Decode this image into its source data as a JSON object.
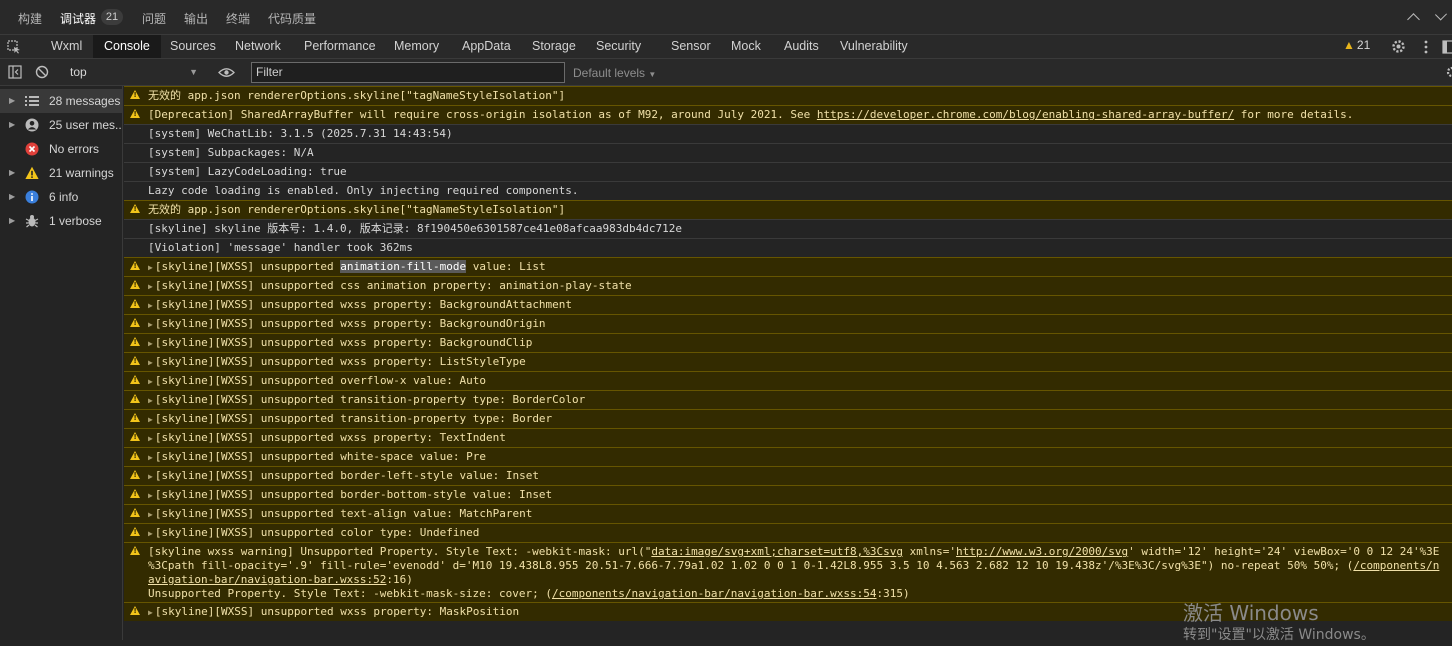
{
  "panel_tabs": [
    "构建",
    "调试器",
    "问题",
    "输出",
    "终端",
    "代码质量"
  ],
  "panel_badge": "21",
  "devtools_tabs": [
    "Wxml",
    "Console",
    "Sources",
    "Network",
    "Performance",
    "Memory",
    "AppData",
    "Storage",
    "Security",
    "Sensor",
    "Mock",
    "Audits",
    "Vulnerability"
  ],
  "warning_count": "21",
  "toolbar": {
    "context": "top",
    "filter_placeholder": "Filter",
    "levels": "Default levels"
  },
  "sidebar": [
    {
      "label": "28 messages",
      "icon": "list-icon"
    },
    {
      "label": "25 user mes...",
      "icon": "user-icon"
    },
    {
      "label": "No errors",
      "icon": "error-icon"
    },
    {
      "label": "21 warnings",
      "icon": "warning-icon"
    },
    {
      "label": "6 info",
      "icon": "info-icon"
    },
    {
      "label": "1 verbose",
      "icon": "bug-icon"
    }
  ],
  "messages": [
    {
      "type": "warn",
      "text": "无效的 app.json rendererOptions.skyline[\"tagNameStyleIsolation\"]"
    },
    {
      "type": "warn",
      "pre": "[Deprecation] SharedArrayBuffer will require cross-origin isolation as of M92, around July 2021. See ",
      "link": "https://developer.chrome.com/blog/enabling-shared-array-buffer/",
      "post": " for more details."
    },
    {
      "type": "log",
      "text": "[system] WeChatLib: 3.1.5 (2025.7.31 14:43:54)"
    },
    {
      "type": "log",
      "text": "[system] Subpackages: N/A"
    },
    {
      "type": "log",
      "text": "[system] LazyCodeLoading: true"
    },
    {
      "type": "log",
      "text": "Lazy code loading is enabled. Only injecting required components."
    },
    {
      "type": "warn",
      "text": "无效的 app.json rendererOptions.skyline[\"tagNameStyleIsolation\"]"
    },
    {
      "type": "log",
      "text": "[skyline] skyline 版本号: 1.4.0, 版本记录: 8f190450e6301587ce41e08afcaa983db4dc712e"
    },
    {
      "type": "log",
      "text": "[Violation] 'message' handler took 362ms"
    },
    {
      "type": "warn-exp",
      "pre": "[skyline][WXSS] unsupported ",
      "hl": "animation-fill-mode",
      "post": " value: List"
    },
    {
      "type": "warn-exp",
      "text": "[skyline][WXSS] unsupported css animation property: animation-play-state"
    },
    {
      "type": "warn-exp",
      "text": "[skyline][WXSS] unsupported wxss property: BackgroundAttachment"
    },
    {
      "type": "warn-exp",
      "text": "[skyline][WXSS] unsupported wxss property: BackgroundOrigin"
    },
    {
      "type": "warn-exp",
      "text": "[skyline][WXSS] unsupported wxss property: BackgroundClip"
    },
    {
      "type": "warn-exp",
      "text": "[skyline][WXSS] unsupported wxss property: ListStyleType"
    },
    {
      "type": "warn-exp",
      "text": "[skyline][WXSS] unsupported overflow-x value: Auto"
    },
    {
      "type": "warn-exp",
      "text": "[skyline][WXSS] unsupported transition-property type: BorderColor"
    },
    {
      "type": "warn-exp",
      "text": "[skyline][WXSS] unsupported transition-property type: Border"
    },
    {
      "type": "warn-exp",
      "text": "[skyline][WXSS] unsupported wxss property: TextIndent"
    },
    {
      "type": "warn-exp",
      "text": "[skyline][WXSS] unsupported white-space value: Pre"
    },
    {
      "type": "warn-exp",
      "text": "[skyline][WXSS] unsupported border-left-style value: Inset"
    },
    {
      "type": "warn-exp",
      "text": "[skyline][WXSS] unsupported border-bottom-style value: Inset"
    },
    {
      "type": "warn-exp",
      "text": "[skyline][WXSS] unsupported text-align value: MatchParent"
    },
    {
      "type": "warn-exp",
      "text": "[skyline][WXSS] unsupported color type: Undefined"
    }
  ],
  "multi_warning": {
    "l1_pre": "[skyline wxss warning] Unsupported Property. Style Text: -webkit-mask: url(\"",
    "l1_link1": "data:image/svg+xml;charset=utf8,%3Csvg",
    "l1_mid": " xmlns='",
    "l1_link2": "http://www.w3.org/2000/svg",
    "l1_post": "' width='12' height='24' viewBox='0 0 12 24'%3E",
    "l2_pre": "%3Cpath fill-opacity='.9' fill-rule='evenodd' d='M10 19.438L8.955 20.51-7.666-7.79a1.02 1.02 0 0 1 0-1.42L8.955 3.5 10 4.563 2.682 12 10 19.438z'/%3E%3C/svg%3E\") no-repeat 50% 50%; (",
    "l2_link": "/components/n",
    "l3_link": "avigation-bar/navigation-bar.wxss:52",
    "l3_post": ":16)",
    "l4_pre": "Unsupported Property. Style Text: -webkit-mask-size: cover; (",
    "l4_link": "/components/navigation-bar/navigation-bar.wxss:54",
    "l4_post": ":315)"
  },
  "last_partial": "[skyline][WXSS] unsupported wxss property: MaskPosition",
  "watermark": {
    "line1": "激活 Windows",
    "line2": "转到\"设置\"以激活 Windows。"
  }
}
